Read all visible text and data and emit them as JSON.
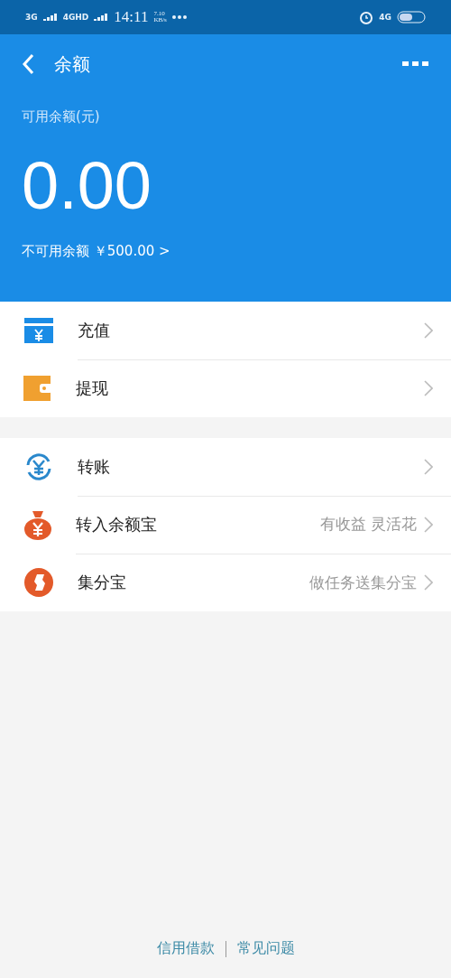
{
  "status_bar": {
    "networks": [
      "3G",
      "4GHD"
    ],
    "time": "14:11",
    "speed": "7.10",
    "speed_unit": "KB/s",
    "right_network": "4G"
  },
  "header": {
    "title": "余额",
    "available_label": "可用余额(元)",
    "amount": "0.00",
    "unavailable": "不可用余额 ￥500.00 >"
  },
  "groups": [
    {
      "items": [
        {
          "kind": "recharge",
          "label": "充值"
        },
        {
          "kind": "withdraw",
          "label": "提现"
        }
      ]
    },
    {
      "items": [
        {
          "kind": "transfer",
          "label": "转账"
        },
        {
          "kind": "moneybag",
          "label": "转入余额宝",
          "note": "有收益 灵活花"
        },
        {
          "kind": "points",
          "label": "集分宝",
          "note": "做任务送集分宝"
        }
      ]
    }
  ],
  "footer": {
    "links": [
      "信用借款",
      "常见问题"
    ]
  }
}
